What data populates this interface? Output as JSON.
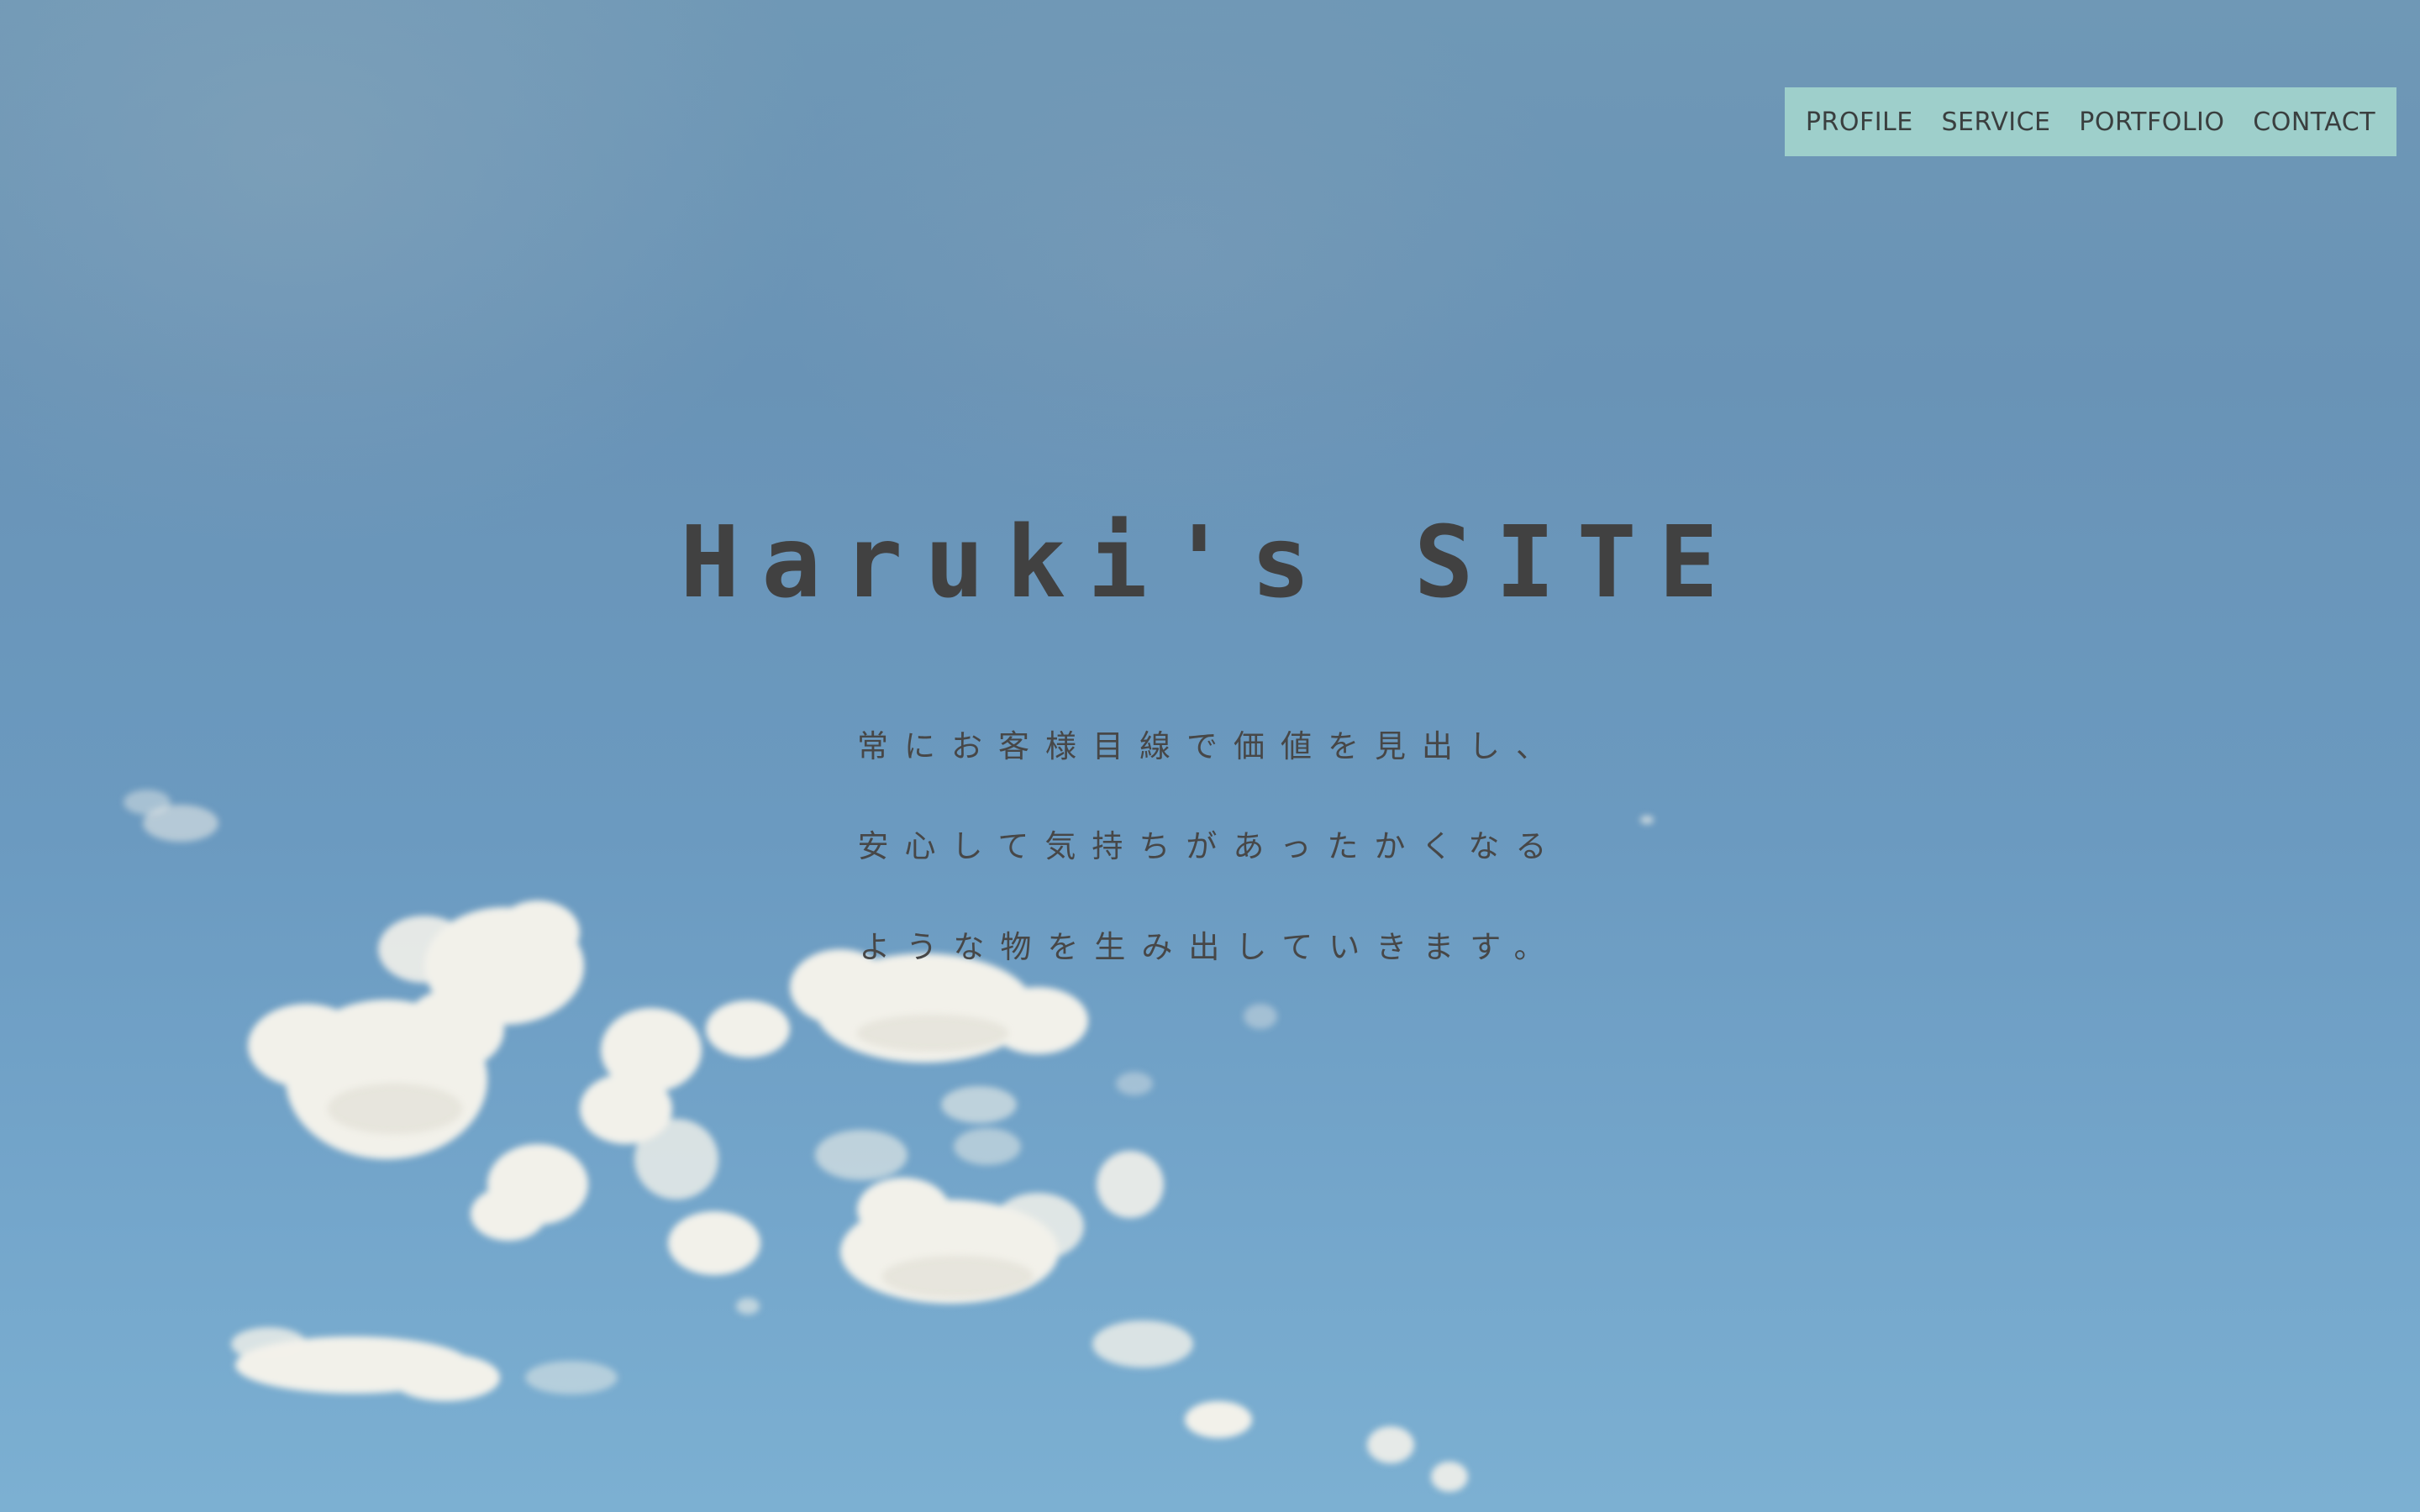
{
  "site": {
    "title": "Haruki's SITE"
  },
  "nav": {
    "items": [
      {
        "label": "PROFILE"
      },
      {
        "label": "SERVICE"
      },
      {
        "label": "PORTFOLIO"
      },
      {
        "label": "CONTACT"
      }
    ],
    "background": "#9ecfcb"
  },
  "hero": {
    "lines": [
      "常にお客様目線で価値を見出し、",
      "安心して気持ちがあったかくなる",
      "ような物を生み出していきます。"
    ],
    "background": "sky-with-clouds-photo",
    "text_color": "#414141"
  }
}
